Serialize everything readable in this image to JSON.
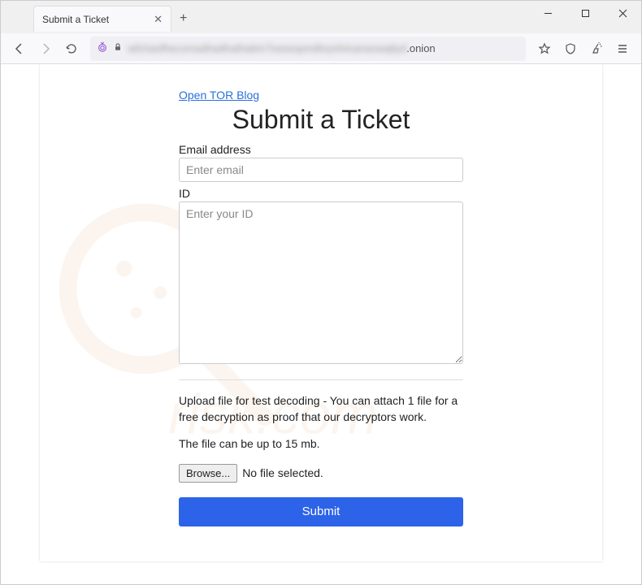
{
  "window": {
    "tab_title": "Submit a Ticket"
  },
  "addressbar": {
    "suffix": ".onion"
  },
  "page": {
    "blog_link": "Open TOR Blog",
    "heading": "Submit a Ticket",
    "email_label": "Email address",
    "email_placeholder": "Enter email",
    "id_label": "ID",
    "id_placeholder": "Enter your ID",
    "upload_text": "Upload file for test decoding - You can attach 1 file for a free decryption as proof that our decryptors work.",
    "size_text": "The file can be up to 15 mb.",
    "browse_label": "Browse...",
    "file_status": "No file selected.",
    "submit_label": "Submit"
  }
}
